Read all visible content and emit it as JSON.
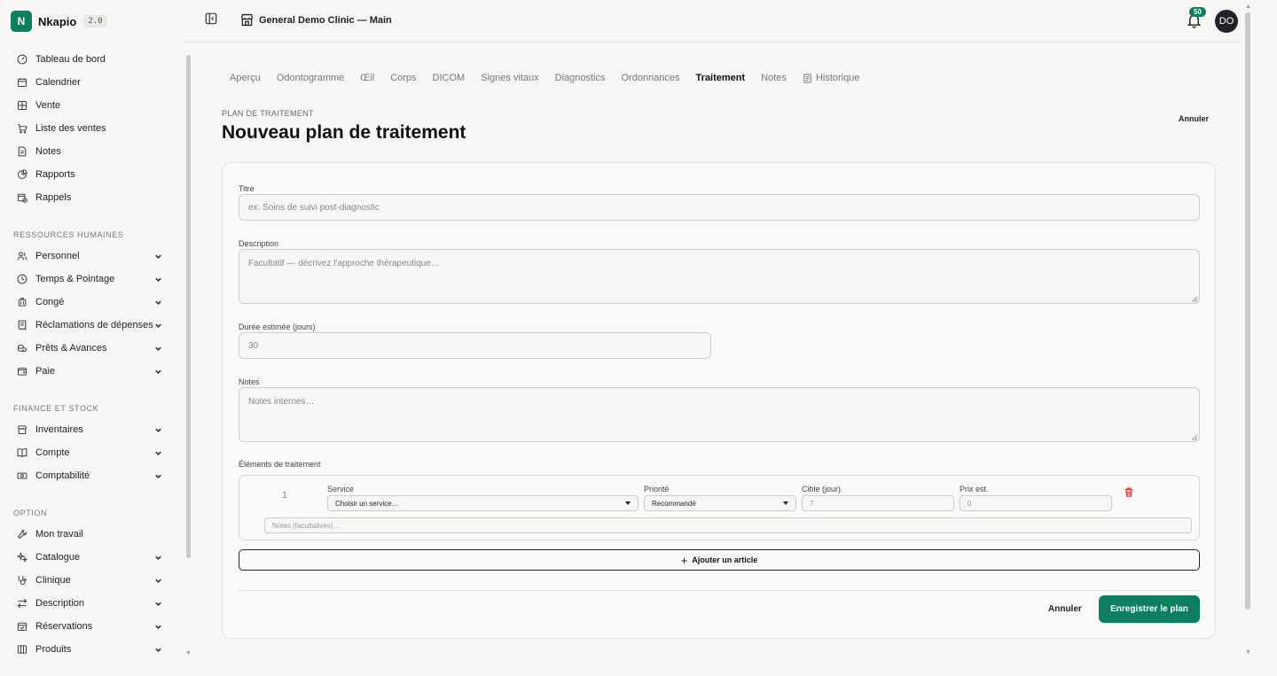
{
  "brand": {
    "logo_letter": "N",
    "name": "Nkapio",
    "version": "2.0",
    "accent": "#0f7d5f"
  },
  "header": {
    "clinic_name": "General Demo Clinic — Main",
    "notification_count": "50",
    "avatar_initials": "DO"
  },
  "sidebar": {
    "main_items": [
      {
        "label": "Tableau de bord",
        "icon": "gauge-icon"
      },
      {
        "label": "Calendrier",
        "icon": "calendar-icon"
      },
      {
        "label": "Vente",
        "icon": "grid-icon"
      },
      {
        "label": "Liste des ventes",
        "icon": "cart-icon"
      },
      {
        "label": "Notes",
        "icon": "note-icon"
      },
      {
        "label": "Rapports",
        "icon": "pie-chart-icon"
      },
      {
        "label": "Rappels",
        "icon": "calendar-clock-icon"
      }
    ],
    "hr_section": "RESSOURCES HUMAINES",
    "hr_items": [
      {
        "label": "Personnel",
        "icon": "users-icon"
      },
      {
        "label": "Temps & Pointage",
        "icon": "clock-icon"
      },
      {
        "label": "Congé",
        "icon": "luggage-icon"
      },
      {
        "label": "Réclamations de dépenses",
        "icon": "receipt-icon"
      },
      {
        "label": "Prêts & Avances",
        "icon": "coins-icon"
      },
      {
        "label": "Paie",
        "icon": "wallet-icon"
      }
    ],
    "finance_section": "FINANCE ET STOCK",
    "finance_items": [
      {
        "label": "Inventaires",
        "icon": "store-icon"
      },
      {
        "label": "Compte",
        "icon": "book-icon"
      },
      {
        "label": "Comptabilité",
        "icon": "money-icon"
      }
    ],
    "option_section": "OPTION",
    "option_items": [
      {
        "label": "Mon travail",
        "icon": "wrench-icon",
        "chevron": false
      },
      {
        "label": "Catalogue",
        "icon": "sparkles-icon",
        "chevron": true
      },
      {
        "label": "Clinique",
        "icon": "stethoscope-icon",
        "chevron": true
      },
      {
        "label": "Description",
        "icon": "arrows-icon",
        "chevron": true
      },
      {
        "label": "Réservations",
        "icon": "calendar-check-icon",
        "chevron": true
      },
      {
        "label": "Produits",
        "icon": "package-icon",
        "chevron": true
      }
    ]
  },
  "tabs": [
    {
      "label": "Aperçu"
    },
    {
      "label": "Odontogramme"
    },
    {
      "label": "Œil"
    },
    {
      "label": "Corps"
    },
    {
      "label": "DICOM"
    },
    {
      "label": "Signes vitaux"
    },
    {
      "label": "Diagnostics"
    },
    {
      "label": "Ordonnances"
    },
    {
      "label": "Traitement",
      "active": true
    },
    {
      "label": "Notes"
    },
    {
      "label": "Historique",
      "icon": "history-icon"
    }
  ],
  "page": {
    "eyebrow": "PLAN DE TRAITEMENT",
    "title": "Nouveau plan de traitement",
    "top_cancel": "Annuler"
  },
  "form": {
    "title_label": "Titre",
    "title_placeholder": "ex. Soins de suivi post-diagnostic",
    "description_label": "Description",
    "description_placeholder": "Facultatif — décrivez l'approche thérapeutique…",
    "duration_label": "Durée estimée (jours)",
    "duration_value": "30",
    "notes_label": "Notes",
    "notes_placeholder": "Notes internes…",
    "items_label": "Éléments de traitement",
    "item": {
      "number": "1",
      "service_label": "Service",
      "service_value": "Choisir un service…",
      "priority_label": "Priorité",
      "priority_value": "Recommandé",
      "target_label": "Cible (jour)",
      "target_placeholder": "7",
      "price_label": "Prix est.",
      "price_placeholder": "0",
      "notes_placeholder": "Notes (facultatives)…"
    },
    "add_item": "Ajouter un article",
    "cancel": "Annuler",
    "save": "Enregistrer le plan"
  }
}
